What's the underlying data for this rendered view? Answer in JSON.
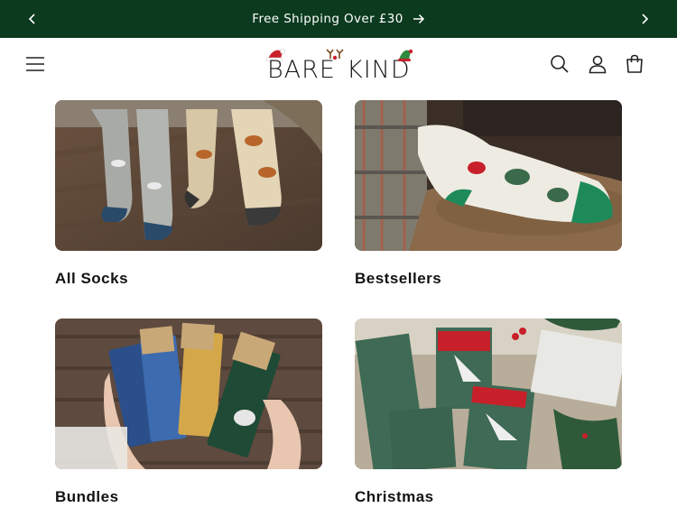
{
  "announcement": {
    "text": "Free Shipping Over £30",
    "prev_icon": "chevron-left-icon",
    "next_icon": "chevron-right-icon",
    "link_icon": "arrow-right-icon"
  },
  "header": {
    "logo_text_left": "BARE",
    "logo_text_right": "KIND",
    "icons": [
      "menu-icon",
      "search-icon",
      "account-icon",
      "cart-icon"
    ]
  },
  "collections": [
    {
      "title": "All Socks"
    },
    {
      "title": "Bestsellers"
    },
    {
      "title": "Bundles"
    },
    {
      "title": "Christmas"
    }
  ],
  "colors": {
    "announcement_bg": "#0b3a1e",
    "text": "#121212",
    "accent_red": "#c8202a"
  }
}
